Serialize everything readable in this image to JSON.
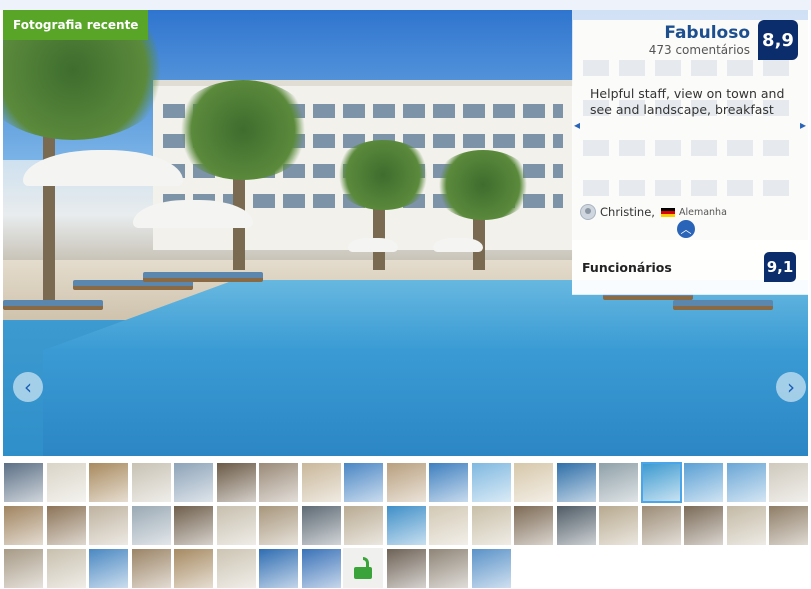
{
  "badge": {
    "label": "Fotografia recente"
  },
  "review": {
    "score_word": "Fabuloso",
    "review_count": "473 comentários",
    "score": "8,9",
    "quote": "Helpful staff, view on town and see and landscape, breakfast",
    "reviewer_name": "Christine,",
    "reviewer_country": "Alemanha",
    "prev_arrow": "◂",
    "next_arrow": "▸",
    "collapse_icon": "︿"
  },
  "category": {
    "label": "Funcionários",
    "score": "9,1"
  },
  "gallery": {
    "prev_icon": "‹",
    "next_icon": "›",
    "selected_index": 15,
    "thumbnail_count": 51
  },
  "thumb_colors": [
    "#5b6f85",
    "#d9d4c7",
    "#a88a5e",
    "#c8c2b4",
    "#8da3b8",
    "#6b5a46",
    "#9a8a78",
    "#c9b79a",
    "#4a86c4",
    "#b89f7e",
    "#3e7fbf",
    "#7fb8e0",
    "#d6c7aa",
    "#2f6fa8",
    "#8fa0a8",
    "#3d9ad0",
    "#5a9fd4",
    "#6aa6d6",
    "#cfc9bd",
    "#a08460",
    "#8c7458",
    "#bfb3a0",
    "#9aa9b4",
    "#6f5f4c",
    "#c7bfae",
    "#a7967c",
    "#5e6a74",
    "#b9ab93",
    "#3f8fc8",
    "#d2c8b4",
    "#c9bfa8",
    "#7d6a55",
    "#4f5c66",
    "#b7a98f",
    "#9c8c76",
    "#7b6b58",
    "#c3b9a5",
    "#8e7d66",
    "#a79a86",
    "#c8c0ae",
    "#4a88c2",
    "#9b8466",
    "#a68a62",
    "#ccc4b3",
    "#2f6db2",
    "#3a72b8",
    "#d8d3c8",
    "#6e6256",
    "#8f8577",
    "#5a92c8"
  ]
}
